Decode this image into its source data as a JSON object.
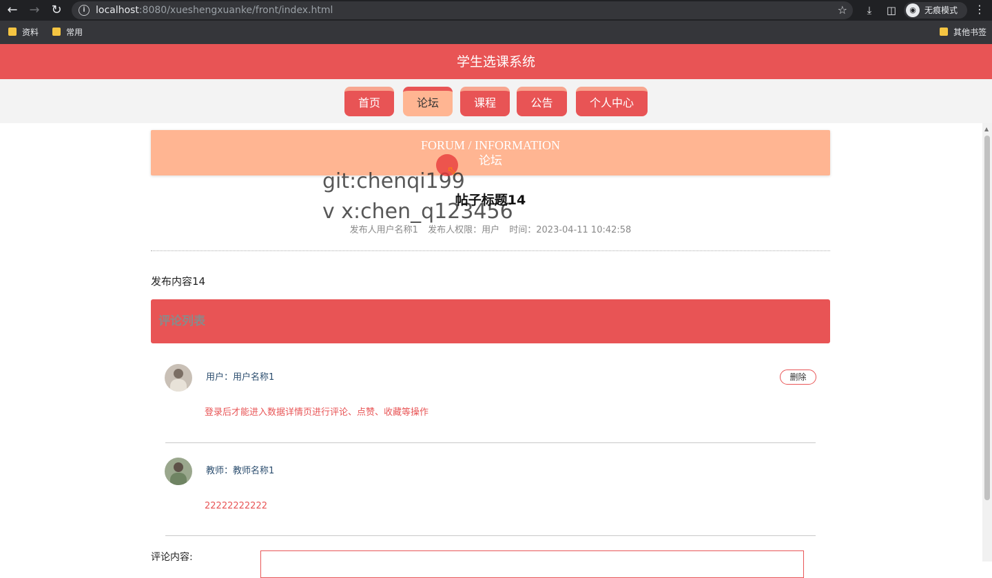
{
  "browser": {
    "url_host": "localhost",
    "url_rest": ":8080/xueshengxuanke/front/index.html",
    "incognito_label": "无痕模式",
    "bookmarks": [
      "资料",
      "常用"
    ],
    "other_bookmarks": "其他书签"
  },
  "header": {
    "title": "学生选课系统"
  },
  "nav": {
    "items": [
      {
        "label": "首页",
        "active": false
      },
      {
        "label": "论坛",
        "active": true
      },
      {
        "label": "课程",
        "active": false
      },
      {
        "label": "公告",
        "active": false
      },
      {
        "label": "个人中心",
        "active": false
      }
    ]
  },
  "banner": {
    "en": "FORUM / INFORMATION",
    "cn": "论坛"
  },
  "watermark": {
    "line1": "git:chenqi199",
    "line2": "v x:chen_q123456"
  },
  "post": {
    "title": "帖子标题14",
    "publisher": "发布人用户名称1",
    "role": "发布人权限：用户",
    "time": "时间：2023-04-11 10:42:58",
    "content": "发布内容14"
  },
  "comments": {
    "header": "评论列表",
    "items": [
      {
        "author": "用户：用户名称1",
        "text": "登录后才能进入数据详情页进行评论、点赞、收藏等操作",
        "delete_label": "删除"
      },
      {
        "author": "教师：教师名称1",
        "text": "22222222222"
      }
    ]
  },
  "form": {
    "label": "评论内容:"
  },
  "colors": {
    "primary": "#e85455",
    "secondary": "#ffb592"
  }
}
